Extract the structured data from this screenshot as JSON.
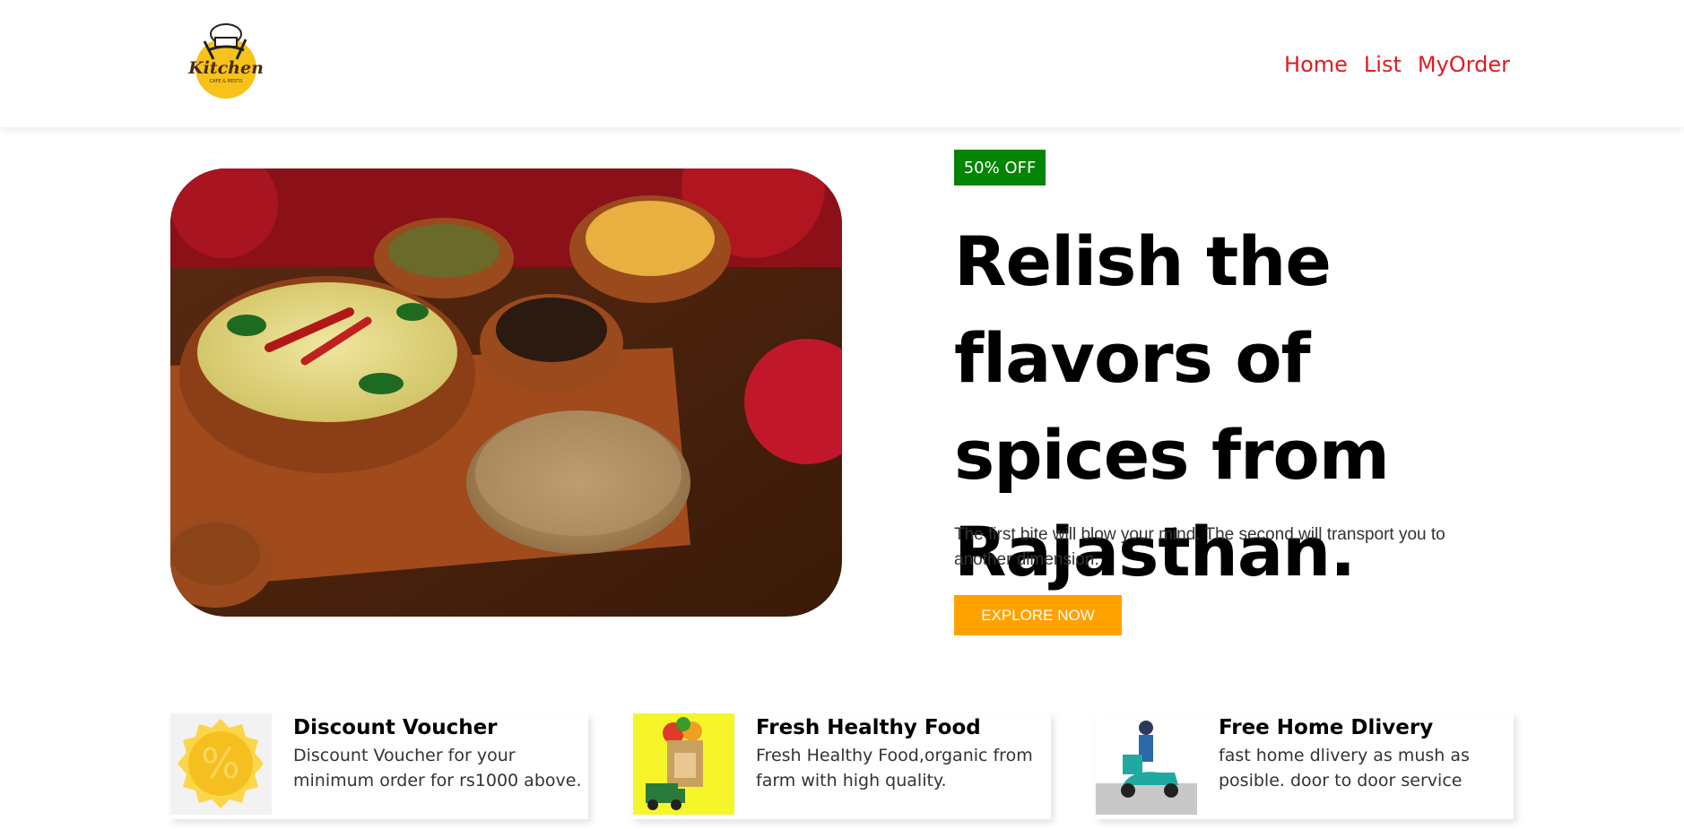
{
  "brand": {
    "logo_text": "Kitchen",
    "logo_subtext": "CAFE & RESTO"
  },
  "nav": {
    "items": [
      "Home",
      "List",
      "MyOrder"
    ]
  },
  "hero": {
    "badge": "50% OFF",
    "title": "Relish the flavors of spices from Rajasthan.",
    "subtitle": "The first bite will blow your mind. The second will transport you to another dimension.",
    "cta": "EXPLORE NOW"
  },
  "features": [
    {
      "title": "Discount Voucher",
      "description": "Discount Voucher for your minimum order for rs1000 above.",
      "icon": "percent-seal-icon"
    },
    {
      "title": "Fresh Healthy Food",
      "description": "Fresh Healthy Food,organic from farm with high quality.",
      "icon": "fresh-food-bag-icon"
    },
    {
      "title": "Free Home Dlivery",
      "description": "fast home dlivery as mush as posible. door to door service",
      "icon": "delivery-scooter-icon"
    }
  ],
  "colors": {
    "nav_link": "#e01b22",
    "badge_bg": "#048404",
    "cta_bg": "#ffa200"
  }
}
